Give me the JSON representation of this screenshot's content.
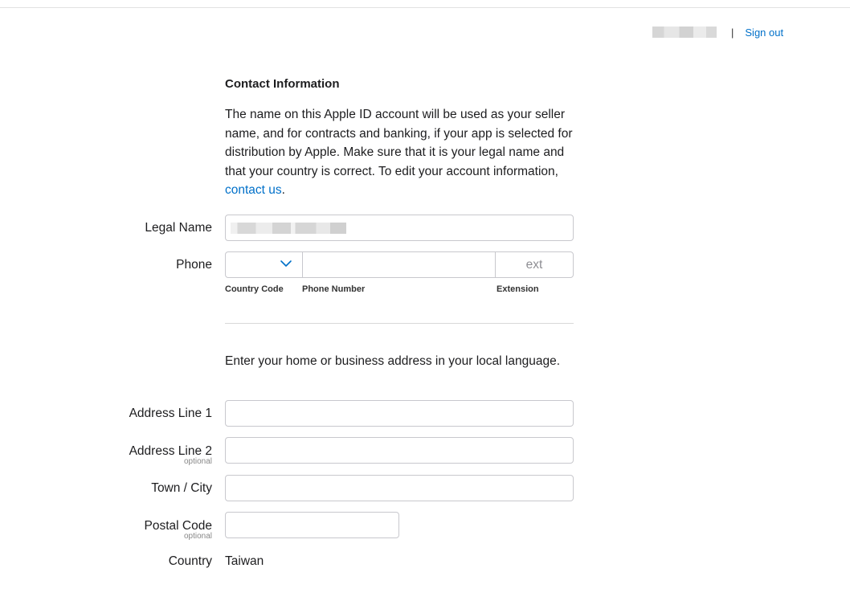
{
  "account": {
    "separator": "|",
    "sign_out": "Sign out"
  },
  "contact": {
    "title": "Contact Information",
    "intro_text": "The name on this Apple ID account will be used as your seller name, and for contracts and banking, if your app is selected for distribution by Apple. Make sure that it is your legal name and that your country is correct. To edit your account information, ",
    "intro_link": "contact us",
    "intro_end": "."
  },
  "form": {
    "legal_name_label": "Legal Name",
    "phone_label": "Phone",
    "ext_placeholder": "ext",
    "country_code_label": "Country Code",
    "phone_number_label": "Phone Number",
    "extension_label": "Extension",
    "address_intro": "Enter your home or business address in your local language.",
    "address1_label": "Address Line 1",
    "address2_label": "Address Line 2",
    "optional_text": "optional",
    "city_label": "Town / City",
    "postal_label": "Postal Code",
    "country_label": "Country",
    "country_value": "Taiwan"
  },
  "icons": {
    "country_code_dropdown": "chevron-down-icon"
  },
  "colors": {
    "link": "#0070c9",
    "border": "#c8c8cd"
  }
}
